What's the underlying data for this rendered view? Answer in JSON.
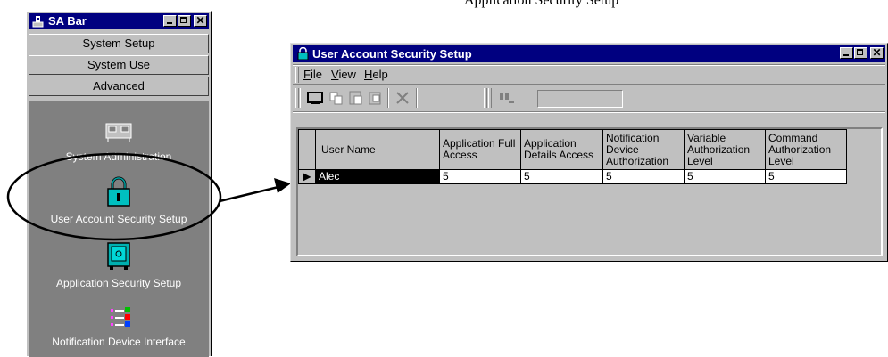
{
  "caption": "Application Security Setup",
  "sa_bar": {
    "title": "SA Bar",
    "categories": [
      "System Setup",
      "System Use",
      "Advanced"
    ],
    "tools": [
      {
        "label": "System Administration",
        "icon": "server-icon"
      },
      {
        "label": "User Account Security Setup",
        "icon": "padlock-icon"
      },
      {
        "label": "Application Security Setup",
        "icon": "safe-icon"
      },
      {
        "label": "Notification Device Interface",
        "icon": "device-list-icon"
      }
    ]
  },
  "window": {
    "title": "User Account Security Setup",
    "menu": [
      {
        "label": "File",
        "accel": "F",
        "rest": "ile"
      },
      {
        "label": "View",
        "accel": "V",
        "rest": "iew"
      },
      {
        "label": "Help",
        "accel": "H",
        "rest": "elp"
      }
    ],
    "toolbar_icons": [
      "new-icon",
      "copy-icon",
      "paste-icon",
      "properties-icon",
      "delete-icon",
      "find-icon"
    ],
    "find_value": "",
    "table": {
      "columns": [
        "User Name",
        "Application Full Access",
        "Application Details Access",
        "Notification Device Authorization",
        "Variable Authorization Level",
        "Command Authorization Level"
      ],
      "rows": [
        [
          "Alec",
          "5",
          "5",
          "5",
          "5",
          "5"
        ]
      ]
    }
  },
  "colors": {
    "title_bar": "#000080",
    "face": "#c0c0c0",
    "panel": "#808080",
    "selection": "#000000"
  }
}
